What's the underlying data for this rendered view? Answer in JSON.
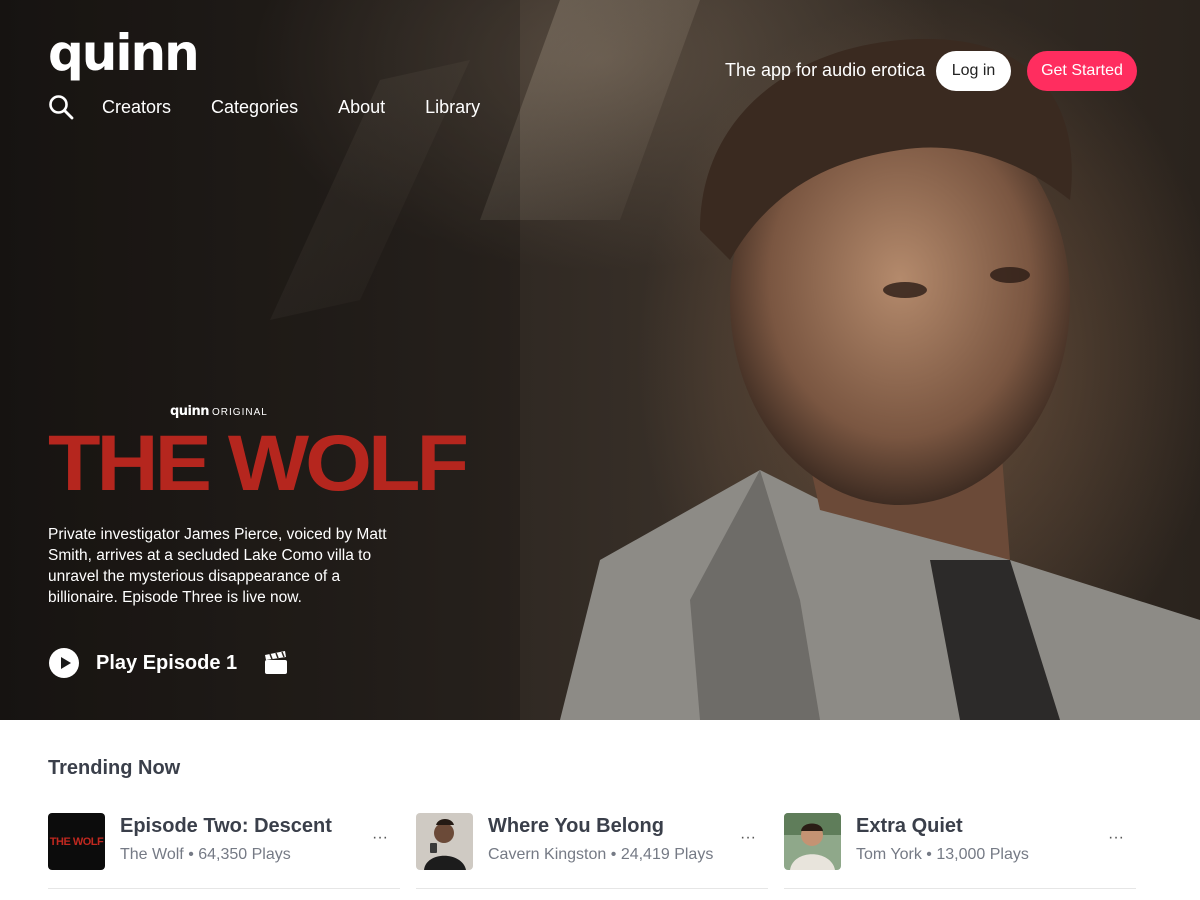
{
  "header": {
    "logo": "quinn",
    "nav": [
      "Creators",
      "Categories",
      "About",
      "Library"
    ],
    "tagline": "The app for audio erotica",
    "login_label": "Log in",
    "get_started_label": "Get Started",
    "accent_color": "#ff2d5f"
  },
  "hero": {
    "badge_logo": "quinn",
    "badge_label": "ORIGINAL",
    "title": "THE WOLF",
    "title_color": "#b5261e",
    "description": "Private investigator James Pierce, voiced by Matt Smith, arrives at a secluded Lake Como villa to unravel the mysterious disappearance of a billionaire. Episode Three is live now.",
    "play_label": "Play Episode 1",
    "icons": [
      "play-icon",
      "clapperboard-icon"
    ]
  },
  "trending": {
    "heading": "Trending Now",
    "items": [
      {
        "title": "Episode Two: Descent",
        "creator": "The Wolf",
        "plays": "64,350 Plays",
        "thumb_text": "THE WOLF",
        "more": "···"
      },
      {
        "title": "Where You Belong",
        "creator": "Cavern Kingston",
        "plays": "24,419 Plays",
        "thumb_text": "",
        "more": "···"
      },
      {
        "title": "Extra Quiet",
        "creator": "Tom York",
        "plays": "13,000 Plays",
        "thumb_text": "",
        "more": "···"
      }
    ],
    "separator": "•"
  }
}
